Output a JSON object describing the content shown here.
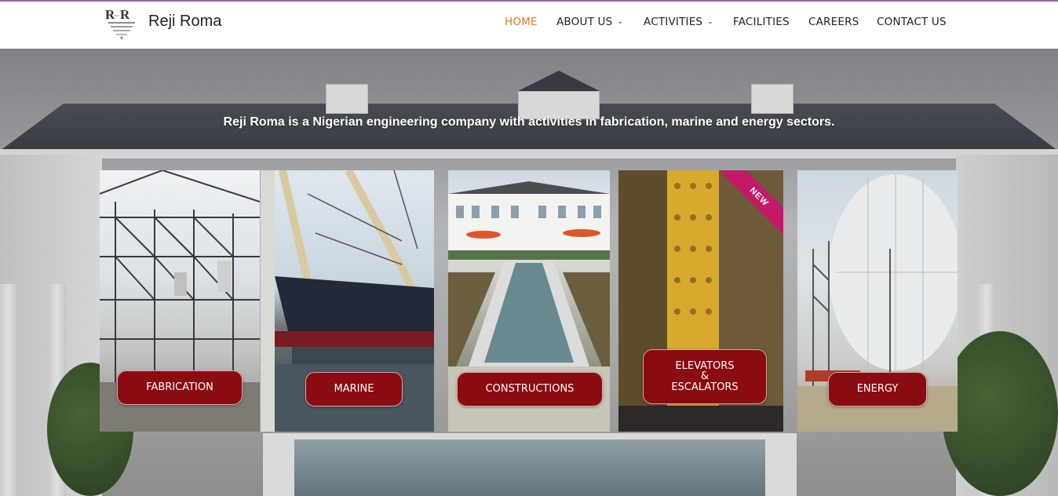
{
  "header": {
    "brand": "Reji Roma",
    "nav": [
      {
        "label": "HOME",
        "active": true,
        "dropdown": false
      },
      {
        "label": "ABOUT US",
        "active": false,
        "dropdown": true
      },
      {
        "label": "ACTIVITIES",
        "active": false,
        "dropdown": true
      },
      {
        "label": "FACILITIES",
        "active": false,
        "dropdown": false
      },
      {
        "label": "CAREERS",
        "active": false,
        "dropdown": false
      },
      {
        "label": "CONTACT US",
        "active": false,
        "dropdown": false
      }
    ],
    "caret": "⌄"
  },
  "hero": {
    "tagline": "Reji Roma is a Nigerian engineering company with activities in fabrication, marine and energy sectors."
  },
  "cards": [
    {
      "label": "FABRICATION"
    },
    {
      "label": "MARINE"
    },
    {
      "label": "CONSTRUCTIONS"
    },
    {
      "label_line1": "ELEVATORS",
      "label_line2": "&",
      "label_line3": "ESCALATORS",
      "ribbon": "NEW"
    },
    {
      "label": "ENERGY"
    }
  ],
  "colors": {
    "accent": "#e8771e",
    "button": "#8b0b12",
    "ribbon": "#c41868"
  }
}
